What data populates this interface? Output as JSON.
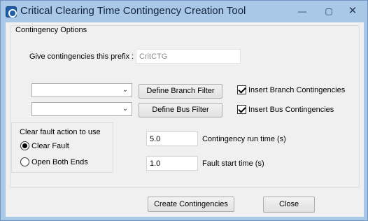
{
  "window": {
    "title": "Critical Clearing Time Contingency Creation Tool",
    "minimize_glyph": "—",
    "maximize_glyph": "▢",
    "close_glyph": "✕"
  },
  "options": {
    "legend": "Contingency Options",
    "prefix_label": "Give contingencies this prefix :",
    "prefix_value": "CritCTG",
    "branch_filter_value": "",
    "define_branch_filter": "Define Branch Filter",
    "insert_branch_label": "Insert Branch Contingencies",
    "insert_branch_checked": true,
    "bus_filter_value": "",
    "define_bus_filter": "Define Bus Filter",
    "insert_bus_label": "Insert Bus Contingencies",
    "insert_bus_checked": true
  },
  "fault_action": {
    "label": "Clear fault action to use",
    "options": [
      {
        "label": "Clear Fault",
        "selected": true
      },
      {
        "label": "Open Both Ends",
        "selected": false
      }
    ]
  },
  "times": {
    "run_time_value": "5.0",
    "run_time_label": "Contingency run time (s)",
    "fault_start_value": "1.0",
    "fault_start_label": "Fault start time (s)"
  },
  "buttons": {
    "create": "Create Contingencies",
    "close": "Close"
  },
  "icons": {
    "app": "app-logo-icon",
    "dropdown": "chevron-down-icon"
  }
}
